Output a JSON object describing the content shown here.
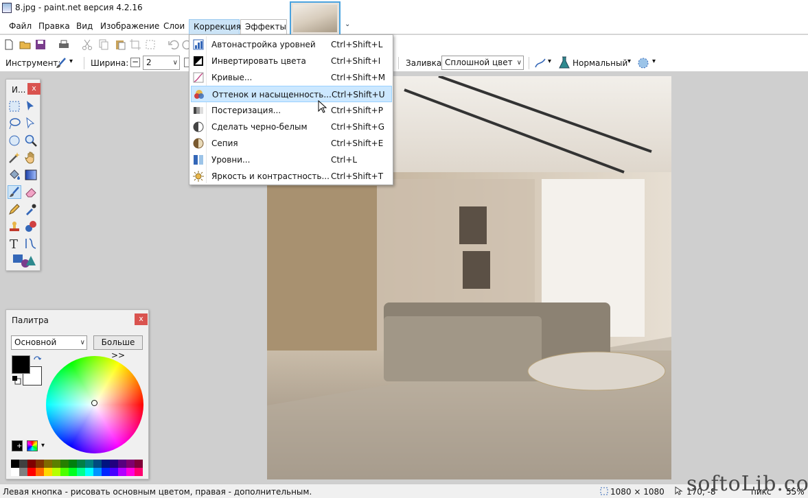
{
  "window": {
    "title": "8.jpg - paint.net версия 4.2.16"
  },
  "menubar": {
    "items": [
      "Файл",
      "Правка",
      "Вид",
      "Изображение",
      "Слои",
      "Коррекция",
      "Эффекты"
    ],
    "active": "Коррекция"
  },
  "toolbar2": {
    "tool_label": "Инструмент:",
    "width_label": "Ширина:",
    "width_value": "2",
    "fill_label": "Заливка:",
    "fill_value": "Сплошной цвет",
    "blend_value": "Нормальный"
  },
  "correction_menu": {
    "items": [
      {
        "label": "Автонастройка уровней",
        "shortcut": "Ctrl+Shift+L",
        "icon": "auto-level-icon"
      },
      {
        "label": "Инвертировать цвета",
        "shortcut": "Ctrl+Shift+I",
        "icon": "invert-colors-icon"
      },
      {
        "label": "Кривые...",
        "shortcut": "Ctrl+Shift+M",
        "icon": "curves-icon"
      },
      {
        "label": "Оттенок и насыщенность...",
        "shortcut": "Ctrl+Shift+U",
        "icon": "hue-saturation-icon"
      },
      {
        "label": "Постеризация...",
        "shortcut": "Ctrl+Shift+P",
        "icon": "posterize-icon"
      },
      {
        "label": "Сделать черно-белым",
        "shortcut": "Ctrl+Shift+G",
        "icon": "black-white-icon"
      },
      {
        "label": "Сепия",
        "shortcut": "Ctrl+Shift+E",
        "icon": "sepia-icon"
      },
      {
        "label": "Уровни...",
        "shortcut": "Ctrl+L",
        "icon": "levels-icon"
      },
      {
        "label": "Яркость и контрастность...",
        "shortcut": "Ctrl+Shift+T",
        "icon": "brightness-contrast-icon"
      }
    ],
    "highlighted": "Оттенок и насыщенность..."
  },
  "tools_panel": {
    "title": "И...",
    "close": "x"
  },
  "palette_panel": {
    "title": "Палитра",
    "close": "x",
    "mode_value": "Основной",
    "more_button": "Больше >>"
  },
  "palette_colors": [
    "#000000",
    "#404040",
    "#7f0000",
    "#7f3300",
    "#7f6a00",
    "#5b7f00",
    "#267f00",
    "#007f0e",
    "#007f46",
    "#007f7f",
    "#004a7f",
    "#00137f",
    "#21007f",
    "#57007f",
    "#7f006e",
    "#7f0037",
    "#ffffff",
    "#808080",
    "#ff0000",
    "#ff6a00",
    "#ffd800",
    "#b6ff00",
    "#4cff00",
    "#00ff21",
    "#00ff90",
    "#00ffff",
    "#0094ff",
    "#0026ff",
    "#4800ff",
    "#b200ff",
    "#ff00dc",
    "#ff006e"
  ],
  "statusbar": {
    "hint": "Левая кнопка - рисовать основным цветом, правая - дополнительным.",
    "image_size": "1080 × 1080",
    "cursor_pos": "170, -8",
    "units": "пикс",
    "zoom": "55%"
  },
  "watermark": "softoLib.com",
  "colors": {
    "accent": "#4aa3df",
    "menu_highlight": "#cce8ff",
    "close_red": "#d9534f"
  }
}
